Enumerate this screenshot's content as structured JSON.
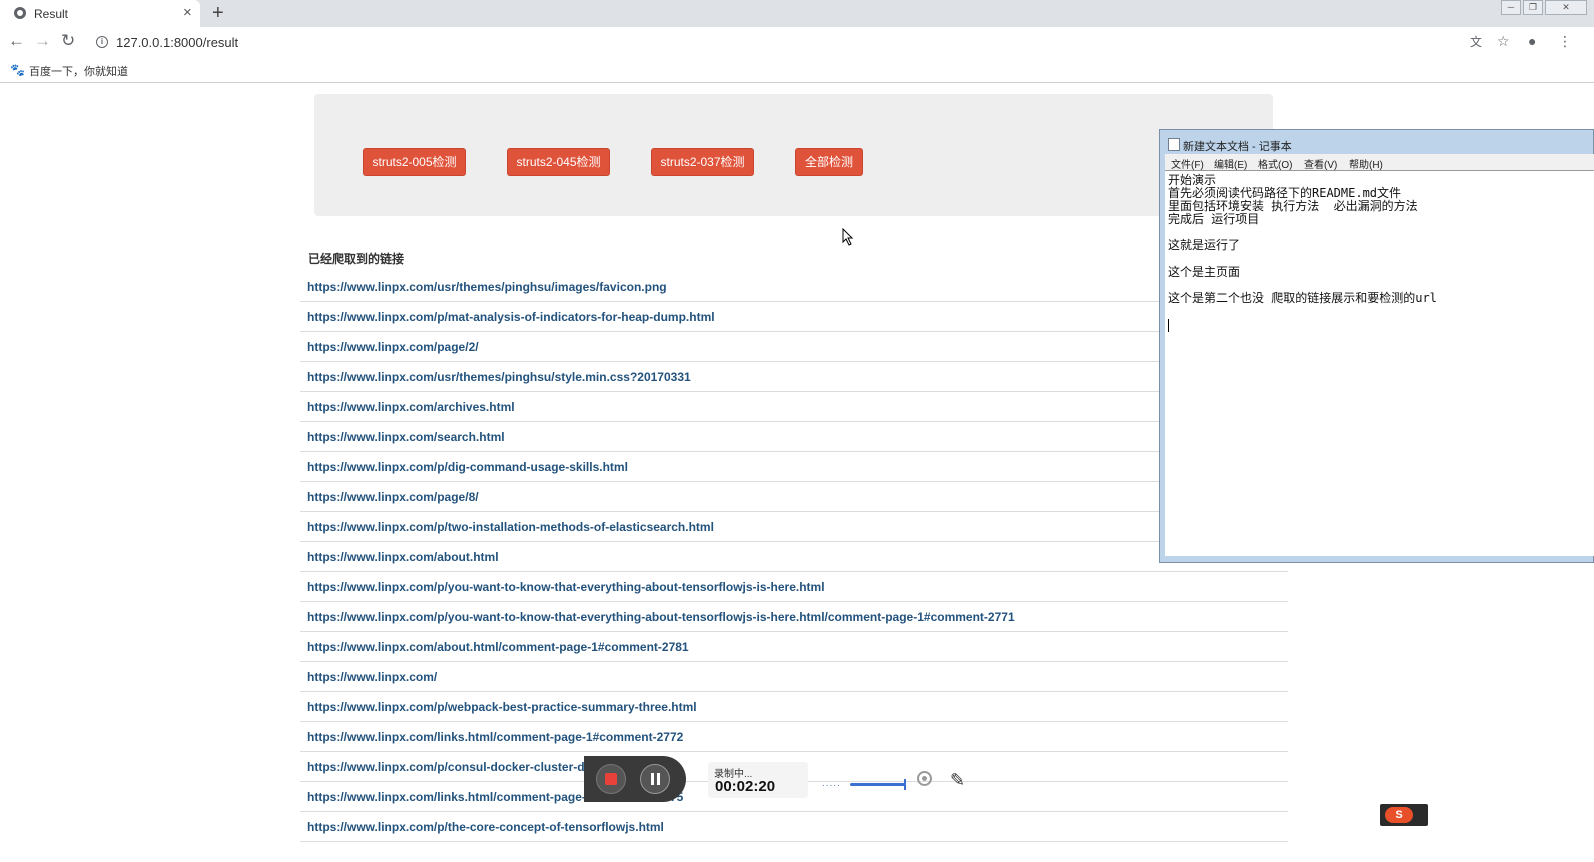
{
  "browser": {
    "tab_title": "Result",
    "tab_close": "×",
    "new_tab": "+",
    "url": "127.0.0.1:8000/result",
    "nav_back": "←",
    "nav_forward": "→",
    "nav_reload": "↻",
    "url_icon": "i",
    "translate_icon": "文",
    "star_icon": "☆",
    "account_icon": "●",
    "menu_icon": "⋮",
    "bookmark_icon": "🐾",
    "bookmark_label": "百度一下，你就知道",
    "win_min": "─",
    "win_max": "❐",
    "win_close": "✕"
  },
  "page": {
    "buttons": [
      "struts2-005检测",
      "struts2-045检测",
      "struts2-037检测",
      "全部检测"
    ],
    "section_title": "已经爬取到的链接",
    "links": [
      "https://www.linpx.com/usr/themes/pinghsu/images/favicon.png",
      "https://www.linpx.com/p/mat-analysis-of-indicators-for-heap-dump.html",
      "https://www.linpx.com/page/2/",
      "https://www.linpx.com/usr/themes/pinghsu/style.min.css?20170331",
      "https://www.linpx.com/archives.html",
      "https://www.linpx.com/search.html",
      "https://www.linpx.com/p/dig-command-usage-skills.html",
      "https://www.linpx.com/page/8/",
      "https://www.linpx.com/p/two-installation-methods-of-elasticsearch.html",
      "https://www.linpx.com/about.html",
      "https://www.linpx.com/p/you-want-to-know-that-everything-about-tensorflowjs-is-here.html",
      "https://www.linpx.com/p/you-want-to-know-that-everything-about-tensorflowjs-is-here.html/comment-page-1#comment-2771",
      "https://www.linpx.com/about.html/comment-page-1#comment-2781",
      "https://www.linpx.com/",
      "https://www.linpx.com/p/webpack-best-practice-summary-three.html",
      "https://www.linpx.com/links.html/comment-page-1#comment-2772",
      "https://www.linpx.com/p/consul-docker-cluster-dep",
      "https://www.linpx.com/links.html/comment-page-1#comment-2775",
      "https://www.linpx.com/p/the-core-concept-of-tensorflowjs.html"
    ]
  },
  "notepad": {
    "title": "新建文本文档 - 记事本",
    "menu": [
      "文件(F)",
      "编辑(E)",
      "格式(O)",
      "查看(V)",
      "帮助(H)"
    ],
    "lines": [
      "开始演示",
      "首先必须阅读代码路径下的README.md文件",
      "里面包括环境安装 执行方法  必出漏洞的方法",
      "完成后 运行项目",
      "这就是运行了",
      "这个是主页面",
      "这个是第二个也没 爬取的链接展示和要检测的url"
    ]
  },
  "recorder": {
    "status": "录制中...",
    "time": "00:02:20",
    "dots": ".....",
    "pen_icon": "✎"
  },
  "tray": {
    "label": "S"
  }
}
